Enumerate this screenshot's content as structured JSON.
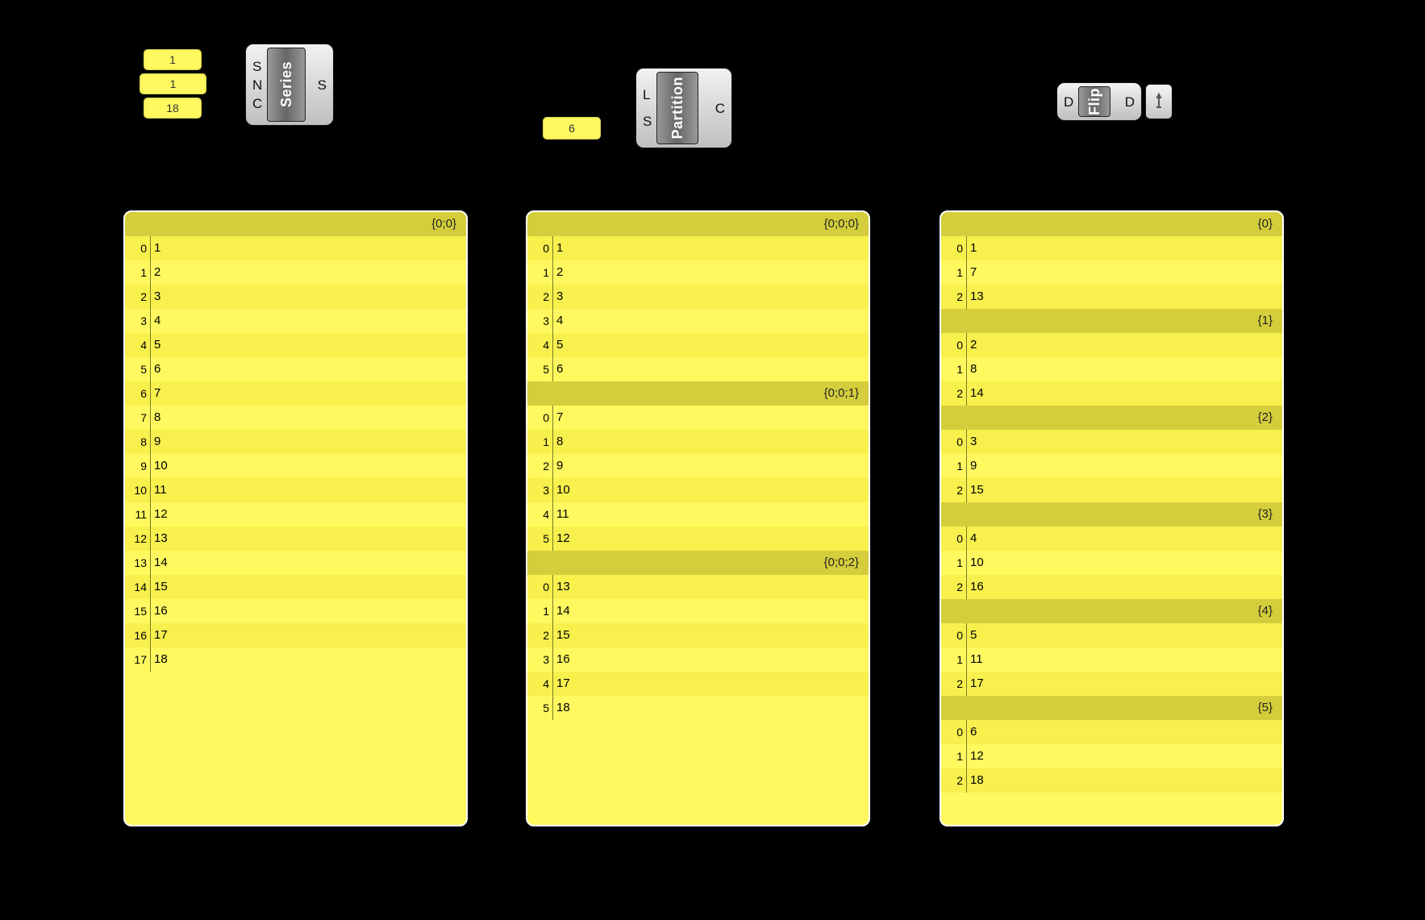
{
  "sliders": {
    "series_start": "1",
    "series_step": "1",
    "series_count": "18",
    "partition_size": "6"
  },
  "components": {
    "series": {
      "label": "Series",
      "in_ports": [
        "S",
        "N",
        "C"
      ],
      "out_ports": [
        "S"
      ]
    },
    "partition": {
      "label": "Partition",
      "in_ports": [
        "L",
        "S"
      ],
      "out_ports": [
        "C"
      ]
    },
    "flip": {
      "label": "Flip",
      "in_ports": [
        "D"
      ],
      "out_ports": [
        "D"
      ]
    }
  },
  "panels": {
    "series_out": {
      "branches": [
        {
          "path": "{0;0}",
          "items": [
            {
              "i": "0",
              "v": "1"
            },
            {
              "i": "1",
              "v": "2"
            },
            {
              "i": "2",
              "v": "3"
            },
            {
              "i": "3",
              "v": "4"
            },
            {
              "i": "4",
              "v": "5"
            },
            {
              "i": "5",
              "v": "6"
            },
            {
              "i": "6",
              "v": "7"
            },
            {
              "i": "7",
              "v": "8"
            },
            {
              "i": "8",
              "v": "9"
            },
            {
              "i": "9",
              "v": "10"
            },
            {
              "i": "10",
              "v": "11"
            },
            {
              "i": "11",
              "v": "12"
            },
            {
              "i": "12",
              "v": "13"
            },
            {
              "i": "13",
              "v": "14"
            },
            {
              "i": "14",
              "v": "15"
            },
            {
              "i": "15",
              "v": "16"
            },
            {
              "i": "16",
              "v": "17"
            },
            {
              "i": "17",
              "v": "18"
            }
          ]
        }
      ]
    },
    "partition_out": {
      "branches": [
        {
          "path": "{0;0;0}",
          "items": [
            {
              "i": "0",
              "v": "1"
            },
            {
              "i": "1",
              "v": "2"
            },
            {
              "i": "2",
              "v": "3"
            },
            {
              "i": "3",
              "v": "4"
            },
            {
              "i": "4",
              "v": "5"
            },
            {
              "i": "5",
              "v": "6"
            }
          ]
        },
        {
          "path": "{0;0;1}",
          "items": [
            {
              "i": "0",
              "v": "7"
            },
            {
              "i": "1",
              "v": "8"
            },
            {
              "i": "2",
              "v": "9"
            },
            {
              "i": "3",
              "v": "10"
            },
            {
              "i": "4",
              "v": "11"
            },
            {
              "i": "5",
              "v": "12"
            }
          ]
        },
        {
          "path": "{0;0;2}",
          "items": [
            {
              "i": "0",
              "v": "13"
            },
            {
              "i": "1",
              "v": "14"
            },
            {
              "i": "2",
              "v": "15"
            },
            {
              "i": "3",
              "v": "16"
            },
            {
              "i": "4",
              "v": "17"
            },
            {
              "i": "5",
              "v": "18"
            }
          ]
        }
      ]
    },
    "flip_out": {
      "branches": [
        {
          "path": "{0}",
          "items": [
            {
              "i": "0",
              "v": "1"
            },
            {
              "i": "1",
              "v": "7"
            },
            {
              "i": "2",
              "v": "13"
            }
          ]
        },
        {
          "path": "{1}",
          "items": [
            {
              "i": "0",
              "v": "2"
            },
            {
              "i": "1",
              "v": "8"
            },
            {
              "i": "2",
              "v": "14"
            }
          ]
        },
        {
          "path": "{2}",
          "items": [
            {
              "i": "0",
              "v": "3"
            },
            {
              "i": "1",
              "v": "9"
            },
            {
              "i": "2",
              "v": "15"
            }
          ]
        },
        {
          "path": "{3}",
          "items": [
            {
              "i": "0",
              "v": "4"
            },
            {
              "i": "1",
              "v": "10"
            },
            {
              "i": "2",
              "v": "16"
            }
          ]
        },
        {
          "path": "{4}",
          "items": [
            {
              "i": "0",
              "v": "5"
            },
            {
              "i": "1",
              "v": "11"
            },
            {
              "i": "2",
              "v": "17"
            }
          ]
        },
        {
          "path": "{5}",
          "items": [
            {
              "i": "0",
              "v": "6"
            },
            {
              "i": "1",
              "v": "12"
            },
            {
              "i": "2",
              "v": "18"
            }
          ]
        }
      ]
    }
  }
}
